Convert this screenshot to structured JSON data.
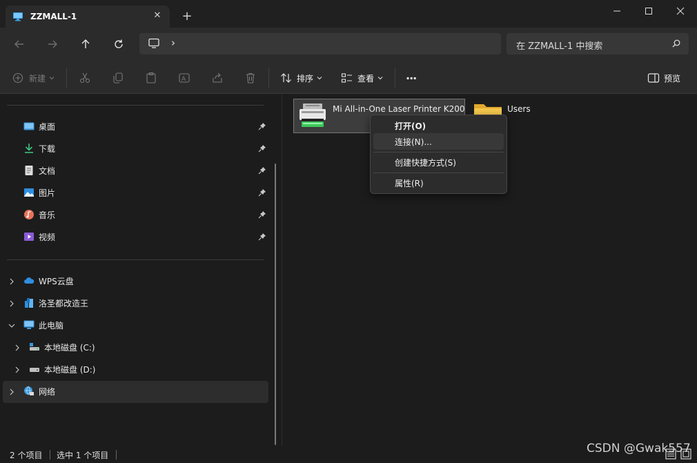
{
  "window": {
    "tab_title": "ZZMALL-1",
    "tab_close": "✕",
    "new_tab": "+",
    "icon": "monitor-icon"
  },
  "address": {
    "breadcrumb_root_icon": "computer-icon",
    "breadcrumb_separator": "›",
    "search_placeholder": "在 ZZMALL-1 中搜索"
  },
  "toolbar": {
    "new_label": "新建",
    "sort_label": "排序",
    "view_label": "查看",
    "more_label": "···",
    "preview_label": "预览"
  },
  "sidebar": {
    "quick_access": [
      {
        "label": "桌面",
        "icon": "desktop-icon"
      },
      {
        "label": "下载",
        "icon": "download-icon"
      },
      {
        "label": "文档",
        "icon": "document-icon"
      },
      {
        "label": "图片",
        "icon": "picture-icon"
      },
      {
        "label": "音乐",
        "icon": "music-icon"
      },
      {
        "label": "视频",
        "icon": "video-icon"
      }
    ],
    "tree": [
      {
        "label": "WPS云盘",
        "icon": "cloud-icon"
      },
      {
        "label": "洛圣都改造王",
        "icon": "onedrive-icon"
      },
      {
        "label": "此电脑",
        "icon": "this-pc-icon"
      },
      {
        "label": "本地磁盘 (C:)",
        "icon": "drive-c-icon"
      },
      {
        "label": "本地磁盘 (D:)",
        "icon": "drive-d-icon"
      },
      {
        "label": "网络",
        "icon": "network-icon"
      }
    ]
  },
  "content": {
    "items": [
      {
        "name": "Mi All-in-One Laser Printer K200",
        "icon": "printer-icon",
        "selected": true
      },
      {
        "name": "Users",
        "icon": "folder-icon",
        "selected": false
      }
    ]
  },
  "context_menu": {
    "items": [
      {
        "label": "打开(O)",
        "bold": true
      },
      {
        "label": "连接(N)...",
        "bold": false
      },
      {
        "label": "创建快捷方式(S)",
        "bold": false
      },
      {
        "label": "属性(R)",
        "bold": false
      }
    ]
  },
  "status": {
    "item_count": "2 个项目",
    "selected_count": "选中 1 个项目"
  },
  "watermark": "CSDN @Gwak557",
  "colors": {
    "background": "#1c1c1c",
    "chrome": "#2b2b2b",
    "folder": "#f5c84c",
    "accent_green": "#3cc85a"
  }
}
